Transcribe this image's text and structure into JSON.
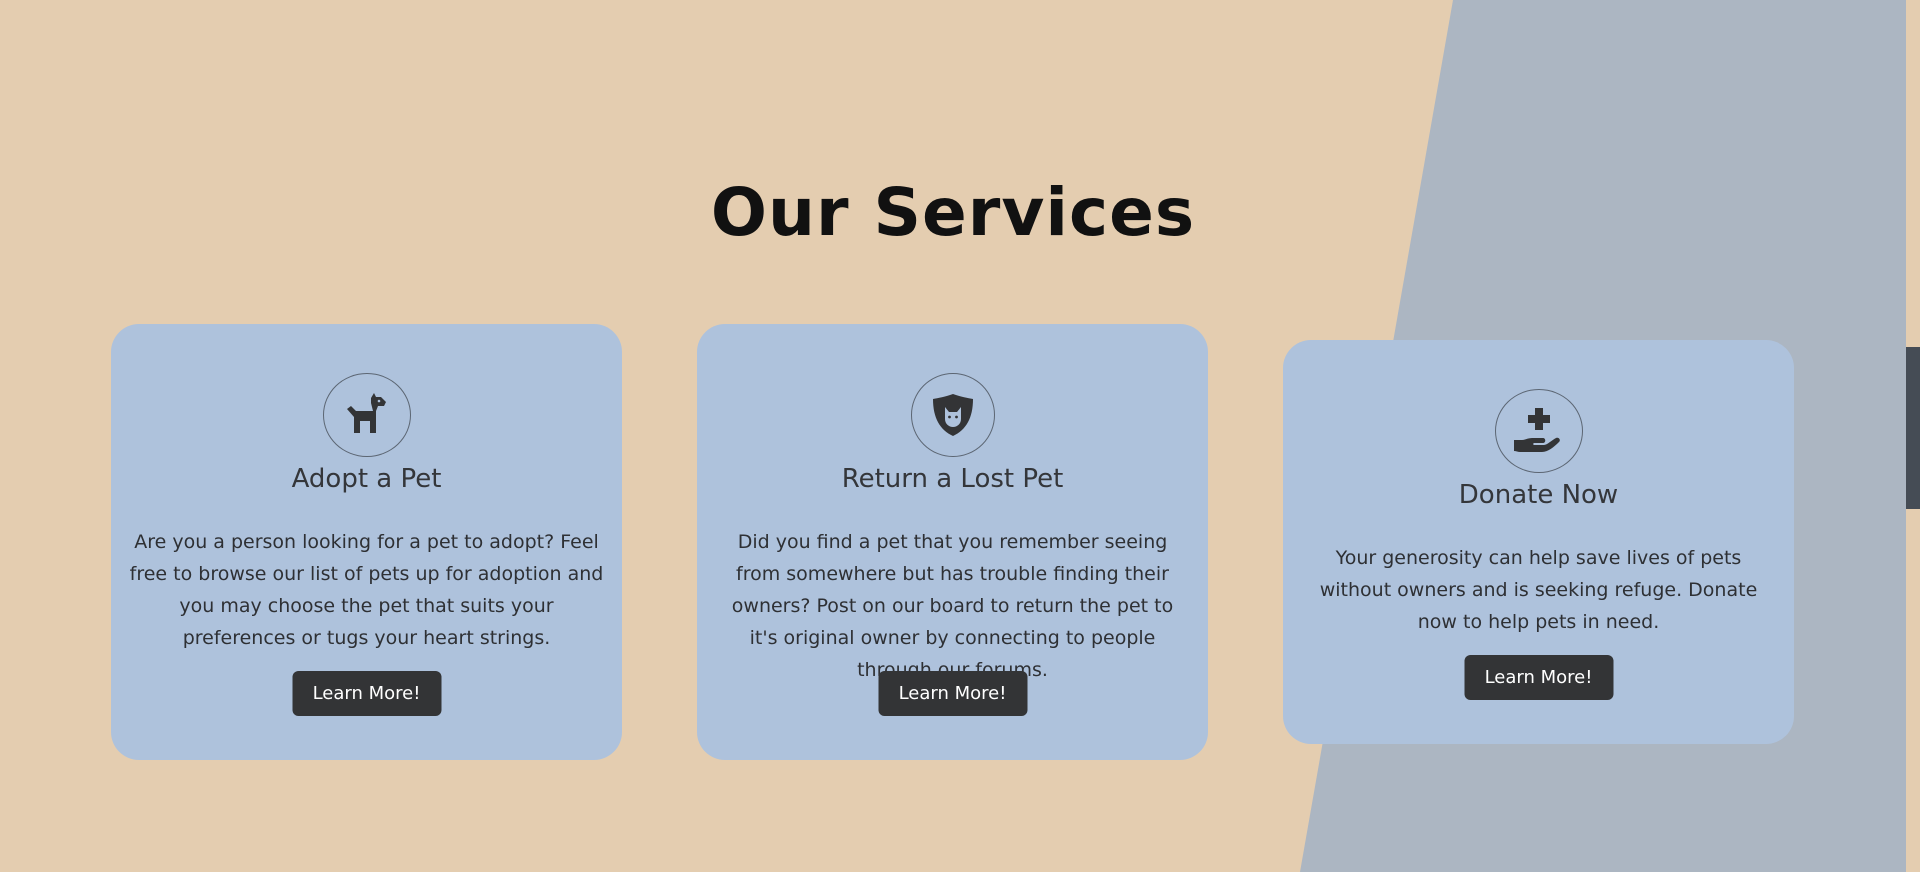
{
  "colors": {
    "background": "#e4cdb0",
    "slant": "#acb6c2",
    "card": "#aec2dc",
    "button": "#333436",
    "title": "#111111"
  },
  "section": {
    "title": "Our Services"
  },
  "cards": [
    {
      "icon": "dog-icon",
      "title": "Adopt a Pet",
      "text": "Are you a person looking for a pet to adopt? Feel free to browse our list of pets up for adoption and you may choose the pet that suits your preferences or tugs your heart strings.",
      "button": "Learn More!"
    },
    {
      "icon": "cat-shield-icon",
      "title": "Return a Lost Pet",
      "text": "Did you find a pet that you remember seeing from somewhere but has trouble finding their owners? Post on our board to return the pet to it's original owner by connecting to people through our forums.",
      "button": "Learn More!"
    },
    {
      "icon": "hand-holding-medical-icon",
      "title": "Donate Now",
      "text": "Your generosity can help save lives of pets without owners and is seeking refuge. Donate now to help pets in need.",
      "button": "Learn More!"
    }
  ]
}
